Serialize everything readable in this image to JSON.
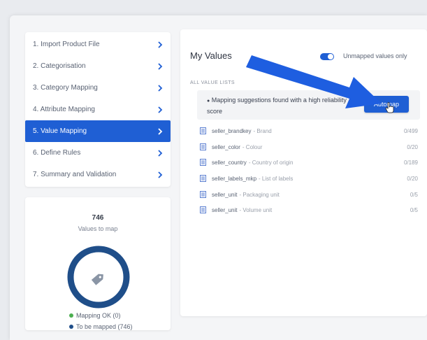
{
  "steps": [
    {
      "label": "1. Import Product File"
    },
    {
      "label": "2. Categorisation"
    },
    {
      "label": "3. Category Mapping"
    },
    {
      "label": "4. Attribute Mapping"
    },
    {
      "label": "5. Value Mapping",
      "active": true
    },
    {
      "label": "6. Define Rules"
    },
    {
      "label": "7. Summary and Validation"
    }
  ],
  "stats": {
    "count": "746",
    "sub": "Values to map",
    "legend_ok": "Mapping OK (0)",
    "legend_todo": "To be mapped (746)",
    "ok_color": "#4caf50",
    "todo_color": "#1f4e89"
  },
  "main": {
    "title": "My Values",
    "toggle_label": "Unmapped values only",
    "section": "ALL VALUE LISTS",
    "suggestion": "Mapping suggestions found with a high reliability score",
    "automap": "Automap",
    "lists": [
      {
        "name": "seller_brandkey",
        "desc": "- Brand",
        "count": "0/499"
      },
      {
        "name": "seller_color",
        "desc": "- Colour",
        "count": "0/20"
      },
      {
        "name": "seller_country",
        "desc": "- Country of origin",
        "count": "0/189"
      },
      {
        "name": "seller_labels_mkp",
        "desc": "- List of labels",
        "count": "0/20"
      },
      {
        "name": "seller_unit",
        "desc": "- Packaging unit",
        "count": "0/5"
      },
      {
        "name": "seller_unit",
        "desc": "- Volume unit",
        "count": "0/5"
      }
    ]
  },
  "colors": {
    "accent": "#1f5fd4",
    "arrow": "#1e5ee0"
  },
  "icons": [
    "chevron-right-icon",
    "tag-icon",
    "list-icon",
    "cursor-hand-icon",
    "pointer-arrow"
  ]
}
